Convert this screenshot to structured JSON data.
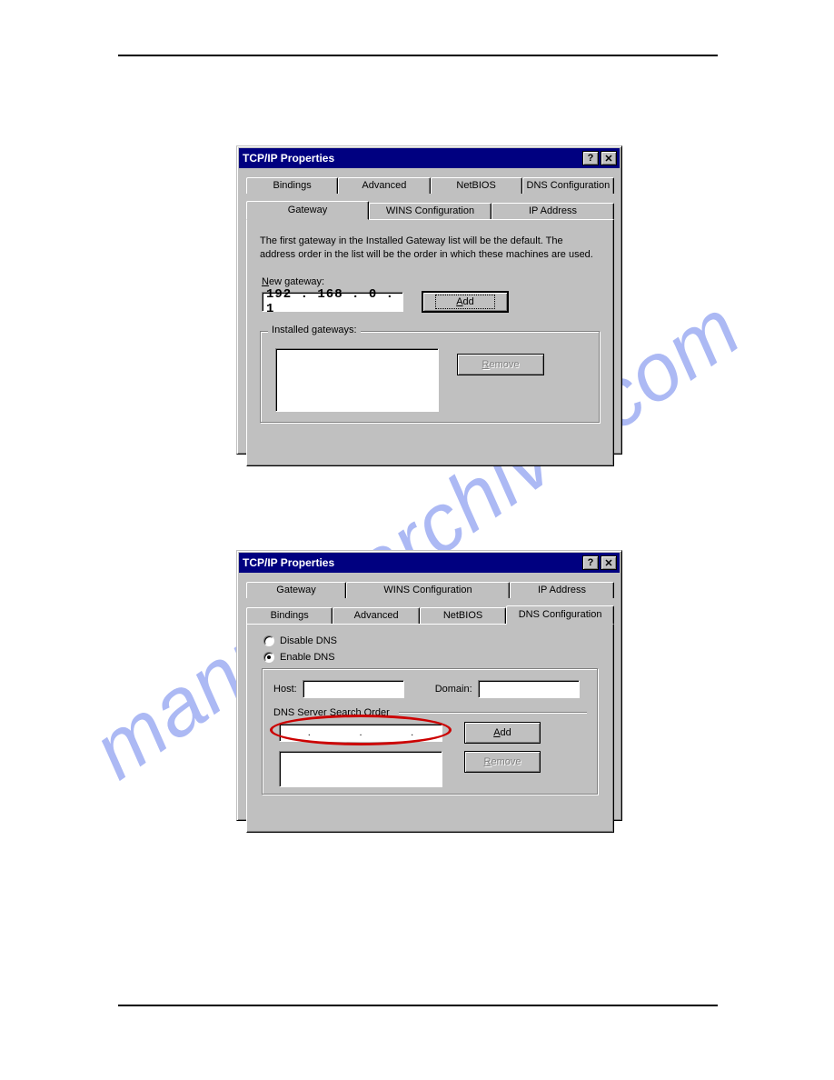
{
  "watermark": "manualsarchive.com",
  "dialog1": {
    "title": "TCP/IP Properties",
    "tabs_back": [
      "Bindings",
      "Advanced",
      "NetBIOS",
      "DNS Configuration"
    ],
    "tabs_front": {
      "gateway": "Gateway",
      "wins": "WINS Configuration",
      "ip": "IP Address"
    },
    "helptext": "The first gateway in the Installed Gateway list will be the default. The address order in the list will be the order in which these machines are used.",
    "new_gateway_label": "New gateway:",
    "new_gateway_value": "192 . 168 .   0   .   1",
    "add_btn": "Add",
    "installed_label": "Installed gateways:",
    "remove_btn": "Remove"
  },
  "dialog2": {
    "title": "TCP/IP Properties",
    "tabs_back": {
      "gateway": "Gateway",
      "wins": "WINS Configuration",
      "ip": "IP Address"
    },
    "tabs_front": [
      "Bindings",
      "Advanced",
      "NetBIOS",
      "DNS Configuration"
    ],
    "disable_dns": "Disable DNS",
    "enable_dns": "Enable DNS",
    "host_label": "Host:",
    "domain_label": "Domain:",
    "dns_order_label": "DNS Server Search Order",
    "add_btn": "Add",
    "remove_btn": "Remove"
  }
}
